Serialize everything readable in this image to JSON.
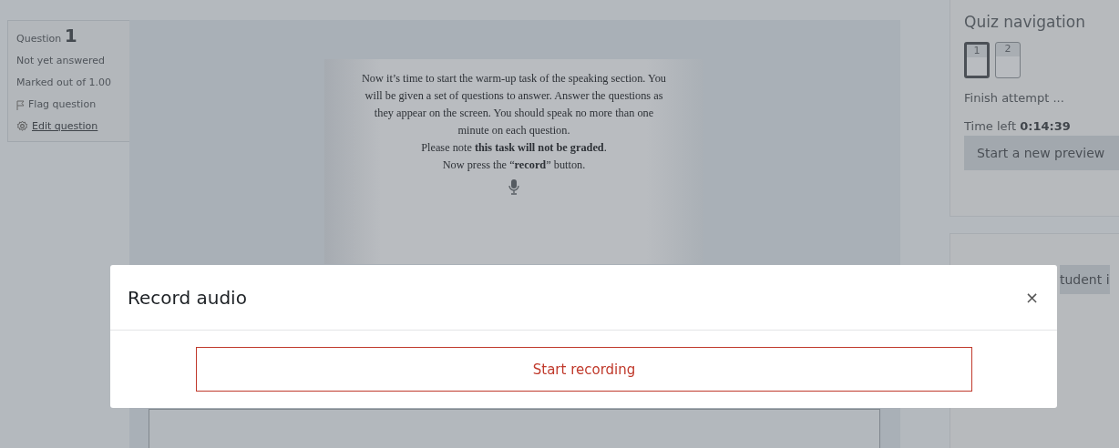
{
  "question_info": {
    "label": "Question",
    "number": "1",
    "status": "Not yet answered",
    "marks": "Marked out of 1.00",
    "flag": "Flag question",
    "edit": "Edit question"
  },
  "question": {
    "text": [
      "Now it’s time to start the warm-up task of the speaking section. You will be given a set of questions to answer. Answer the questions as they appear on the screen. You should speak no more than one minute on each question.",
      "Please note **this task will not be graded**.",
      "Now press the “**record**” button."
    ]
  },
  "quiz_navigation": {
    "title": "Quiz navigation",
    "questions": [
      {
        "label": "1",
        "selected": true
      },
      {
        "label": "2",
        "selected": false
      }
    ],
    "finish": "Finish attempt ...",
    "time_label": "Time left",
    "time": "0:14:39",
    "preview_button": "Start a new preview"
  },
  "side_button": "tudent i",
  "modal": {
    "title": "Record audio",
    "close": "×",
    "button": "Start recording"
  }
}
